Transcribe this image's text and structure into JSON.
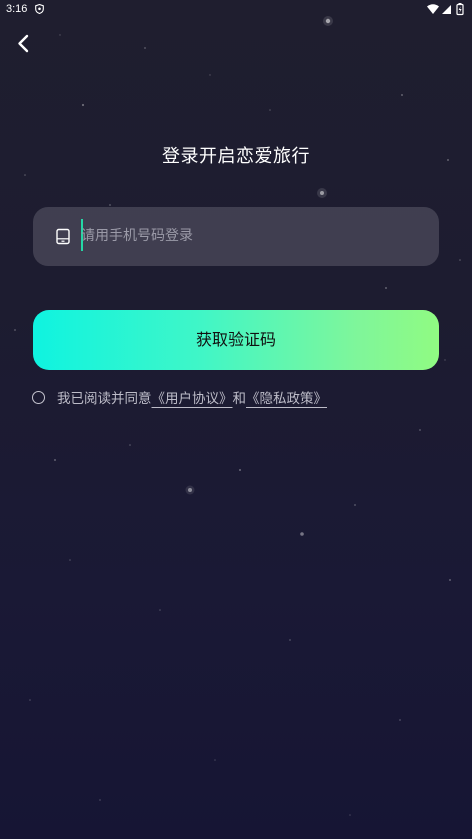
{
  "status_bar": {
    "time": "3:16"
  },
  "header": {
    "back_icon": "chevron-left-icon"
  },
  "page": {
    "title": "登录开启恋爱旅行"
  },
  "phone_input": {
    "icon": "phone-icon",
    "placeholder": "请用手机号码登录",
    "value": ""
  },
  "primary_button": {
    "label": "获取验证码"
  },
  "agreement": {
    "prefix": "我已阅读并同意",
    "user_agreement": "《用户协议》",
    "conjunction": "和",
    "privacy_policy": "《隐私政策》"
  },
  "colors": {
    "background": "#1e1d31",
    "button_gradient_start": "#0ff3e0",
    "button_gradient_end": "#90fb82",
    "caret": "#25d7a6"
  }
}
